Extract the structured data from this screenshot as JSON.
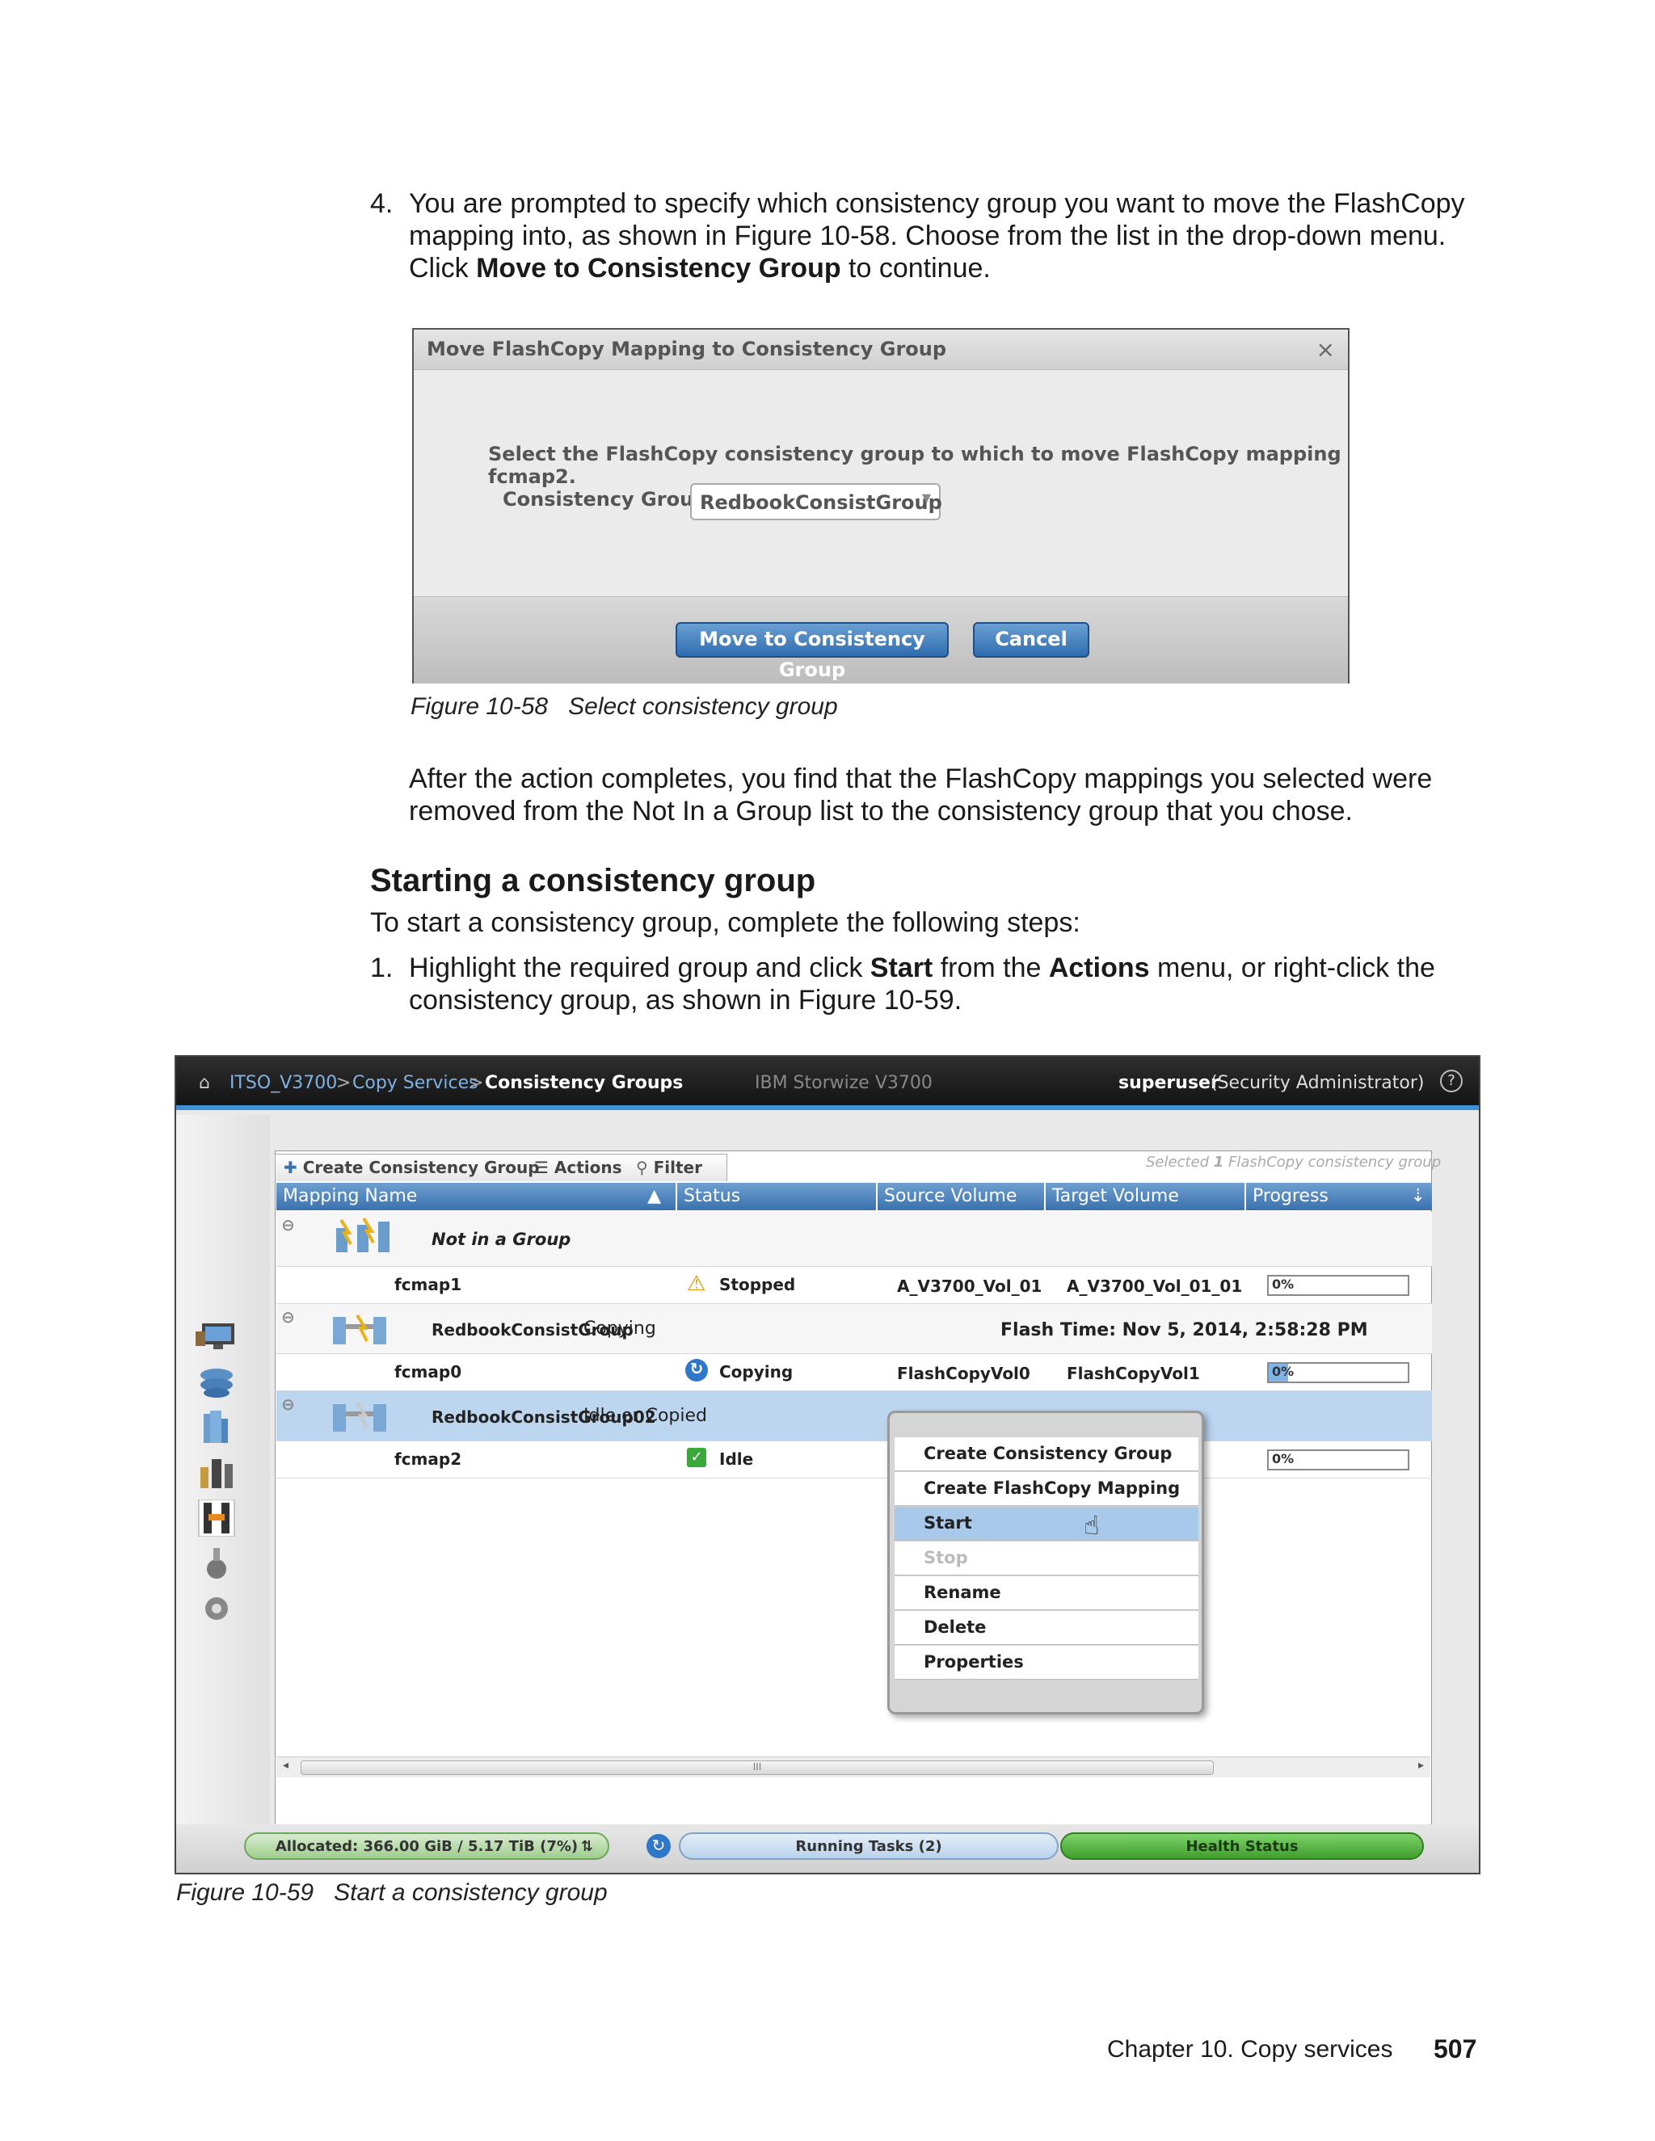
{
  "step4": {
    "number": "4.",
    "line1": "You are prompted to specify which consistency group you want to move the FlashCopy",
    "line2": "mapping into, as shown in Figure 10-58. Choose from the list in the drop-down menu.",
    "line3_pre": "Click ",
    "line3_bold": "Move to Consistency Group",
    "line3_post": " to continue."
  },
  "dialog": {
    "title": "Move FlashCopy Mapping to Consistency Group",
    "close": "×",
    "prompt": "Select the FlashCopy consistency group to which to move FlashCopy mapping fcmap2.",
    "group_label": "Consistency Group",
    "group_value": "RedbookConsistGroup",
    "move_button": "Move to Consistency Group",
    "cancel_button": "Cancel"
  },
  "fig58": {
    "number": "Figure 10-58",
    "text": "Select consistency group"
  },
  "after": {
    "line1": "After the action completes, you find that the FlashCopy mappings you selected were",
    "line2": "removed from the Not In a Group list to the consistency group that you chose."
  },
  "section": {
    "heading": "Starting a consistency group",
    "intro": "To start a consistency group, complete the following steps:"
  },
  "step1": {
    "number": "1.",
    "l1_a": "Highlight the required group and click ",
    "l1_b": "Start",
    "l1_c": " from the ",
    "l1_d": "Actions",
    "l1_e": " menu, or right-click the",
    "line2": "consistency group, as shown in Figure 10-59."
  },
  "gui": {
    "breadcrumb": {
      "home": "ITSO_V3700",
      "sep1": ">",
      "section": "Copy Services",
      "sep2": ">",
      "current": "Consistency Groups"
    },
    "product": "IBM Storwize V3700",
    "user": "superuser",
    "role": "(Security Administrator)",
    "help": "?",
    "toolbar": {
      "create": "Create Consistency Group",
      "actions": "Actions",
      "filter": "Filter"
    },
    "selection_note_a": "Selected ",
    "selection_note_b": "1",
    "selection_note_c": " FlashCopy consistency group",
    "columns": [
      "Mapping Name",
      "Status",
      "Source Volume",
      "Target Volume",
      "Progress"
    ],
    "groups": [
      {
        "name": "Not in a Group",
        "status": ""
      },
      {
        "name": "RedbookConsistGroup",
        "status": "Copying",
        "flash_time": "Flash Time: Nov 5, 2014, 2:58:28 PM"
      },
      {
        "name": "RedbookConsistGroup02",
        "status": "Idle or Copied"
      }
    ],
    "mappings": [
      {
        "name": "fcmap1",
        "status": "Stopped",
        "source": "A_V3700_Vol_01",
        "target": "A_V3700_Vol_01_01",
        "progress": "0%"
      },
      {
        "name": "fcmap0",
        "status": "Copying",
        "source": "FlashCopyVol0",
        "target": "FlashCopyVol1",
        "progress": "0%"
      },
      {
        "name": "fcmap2",
        "status": "Idle",
        "source": "",
        "target": "",
        "progress": "0%"
      }
    ],
    "context_menu": [
      "Create Consistency Group",
      "Create FlashCopy Mapping",
      "Start",
      "Stop",
      "Rename",
      "Delete",
      "Properties"
    ],
    "statusbar": {
      "allocated": "Allocated: 366.00 GiB / 5.17 TiB (7%)",
      "tasks": "Running Tasks (2)",
      "health": "Health Status"
    },
    "scroll_grip": "III"
  },
  "fig59": {
    "number": "Figure 10-59",
    "text": "Start a consistency group"
  },
  "footer": {
    "chapter": "Chapter 10. Copy services",
    "page": "507"
  },
  "colors": {
    "accent": "#3d8fd6",
    "header_blue": "#3a71ad",
    "selected_row": "#bcd6f0",
    "health_green": "#4caf3a"
  }
}
